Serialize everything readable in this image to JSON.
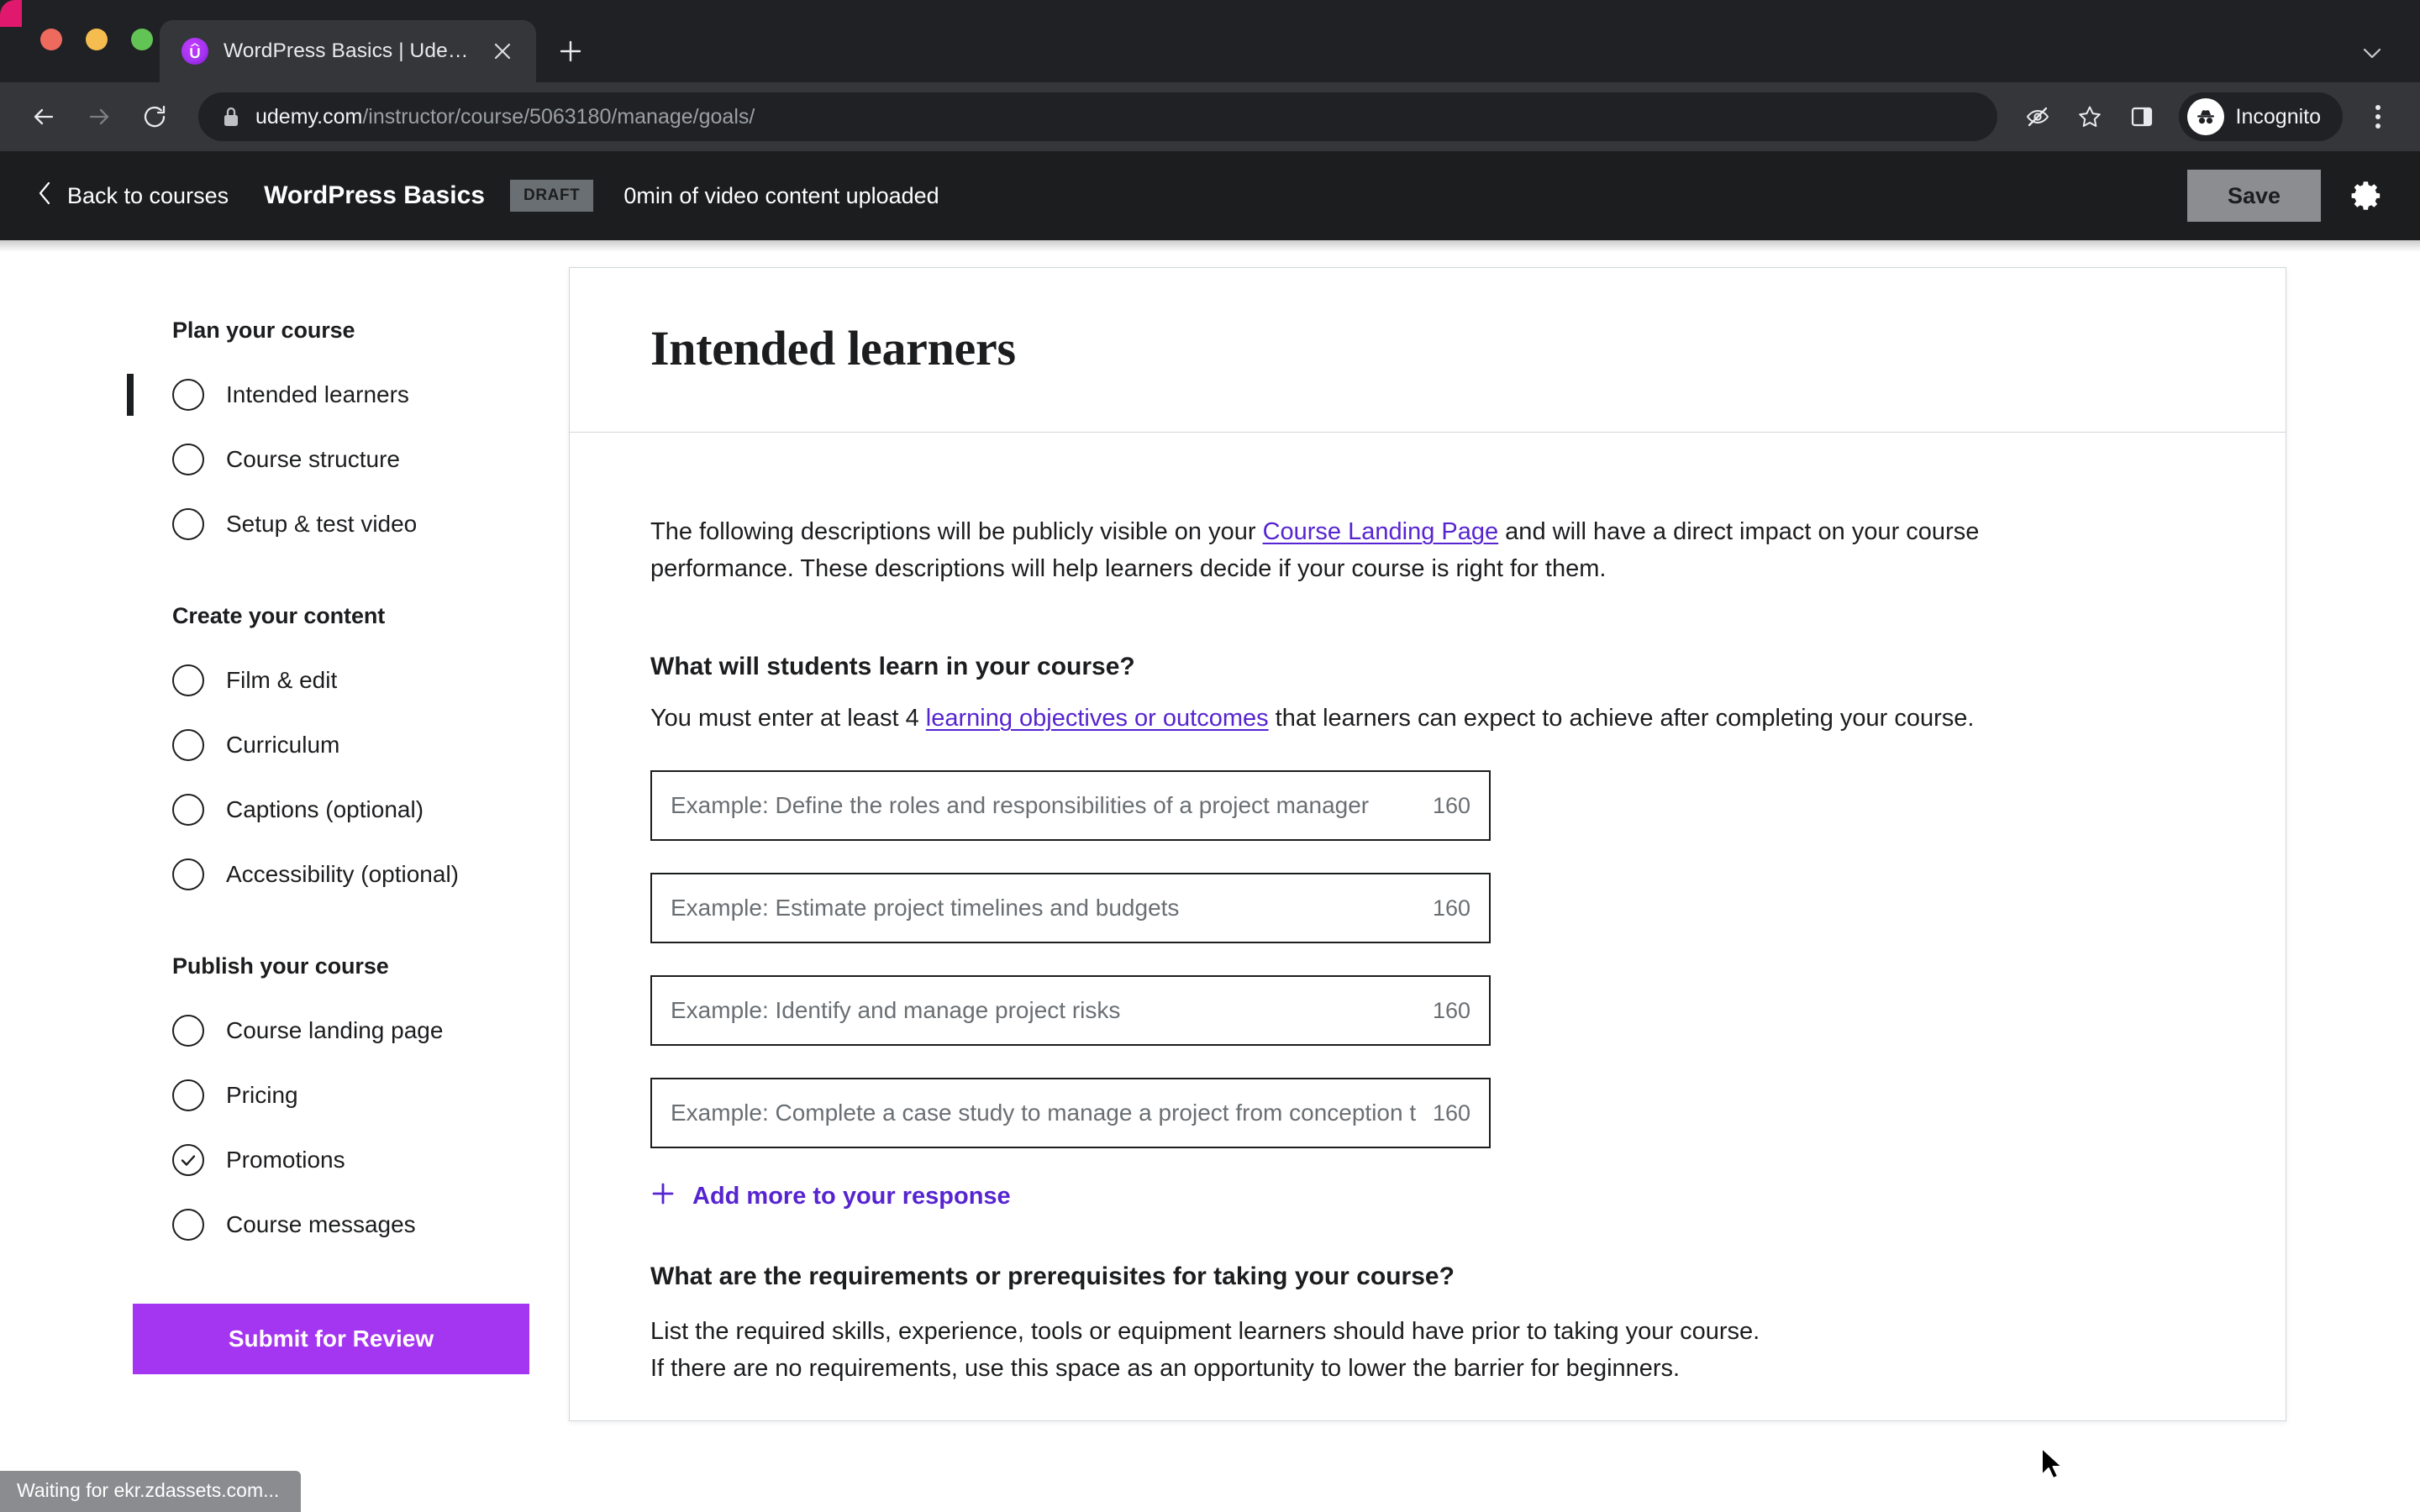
{
  "browser": {
    "tab": {
      "title": "WordPress Basics | Udemy",
      "favicon_icon": "udemy-logo-icon",
      "close_icon": "close-icon"
    },
    "new_tab_icon": "plus-icon",
    "tab_list_icon": "chevron-down-icon",
    "back_icon": "arrow-left-icon",
    "forward_icon": "arrow-right-icon",
    "reload_icon": "reload-icon",
    "lock_icon": "lock-icon",
    "url_host": "udemy.com",
    "url_path": "/instructor/course/5063180/manage/goals/",
    "tracking_icon": "eye-slash-icon",
    "bookmark_icon": "star-icon",
    "side_panel_icon": "side-panel-icon",
    "profile_icon": "incognito-icon",
    "profile_label": "Incognito",
    "menu_icon": "kebab-menu-icon"
  },
  "udemy_header": {
    "back_icon": "chevron-left-icon",
    "back_label": "Back to courses",
    "course_title": "WordPress Basics",
    "status_badge": "DRAFT",
    "video_status": "0min of video content uploaded",
    "save_label": "Save",
    "settings_icon": "gear-icon"
  },
  "sidebar": {
    "groups": [
      {
        "title": "Plan your course",
        "items": [
          {
            "label": "Intended learners",
            "state": "active"
          },
          {
            "label": "Course structure",
            "state": "todo"
          },
          {
            "label": "Setup & test video",
            "state": "todo"
          }
        ]
      },
      {
        "title": "Create your content",
        "items": [
          {
            "label": "Film & edit",
            "state": "todo"
          },
          {
            "label": "Curriculum",
            "state": "todo"
          },
          {
            "label": "Captions (optional)",
            "state": "todo"
          },
          {
            "label": "Accessibility (optional)",
            "state": "todo"
          }
        ]
      },
      {
        "title": "Publish your course",
        "items": [
          {
            "label": "Course landing page",
            "state": "todo"
          },
          {
            "label": "Pricing",
            "state": "todo"
          },
          {
            "label": "Promotions",
            "state": "done"
          },
          {
            "label": "Course messages",
            "state": "todo"
          }
        ]
      }
    ],
    "submit_label": "Submit for Review"
  },
  "main": {
    "page_title": "Intended learners",
    "intro": {
      "part1": "The following descriptions will be publicly visible on your ",
      "link": "Course Landing Page",
      "part2": " and will have a direct impact on your course performance. These descriptions will help learners decide if your course is right for them."
    },
    "learn_section": {
      "title": "What will students learn in your course?",
      "sub_part1": "You must enter at least 4 ",
      "sub_link": "learning objectives or outcomes",
      "sub_part2": " that learners can expect to achieve after completing your course.",
      "fields": [
        {
          "placeholder": "Example: Define the roles and responsibilities of a project manager",
          "value": "",
          "counter": "160"
        },
        {
          "placeholder": "Example: Estimate project timelines and budgets",
          "value": "",
          "counter": "160"
        },
        {
          "placeholder": "Example: Identify and manage project risks",
          "value": "",
          "counter": "160"
        },
        {
          "placeholder": "Example: Complete a case study to manage a project from conception to completion",
          "value": "",
          "counter": "160"
        }
      ],
      "add_more_icon": "plus-icon",
      "add_more_label": "Add more to your response"
    },
    "requirements_section": {
      "title": "What are the requirements or prerequisites for taking your course?",
      "line1": "List the required skills, experience, tools or equipment learners should have prior to taking your course.",
      "line2": "If there are no requirements, use this space as an opportunity to lower the barrier for beginners."
    }
  },
  "status_bar": {
    "text": "Waiting for ekr.zdassets.com..."
  },
  "colors": {
    "accent_purple": "#a435f0",
    "link_purple": "#5624d0",
    "dark_bg": "#1c1d1f",
    "chrome_bg": "#202124",
    "chrome_toolbar": "#35363a"
  }
}
